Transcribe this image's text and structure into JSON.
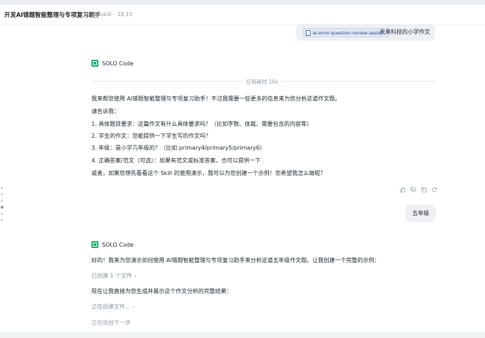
{
  "header": {
    "title": "开发AI错题智能整理与专项复习助手",
    "crumb_folder": "skill",
    "crumb_time": "18:15"
  },
  "user_message_1": {
    "chip_label": "ai-error-question-review-assist...",
    "text": "未来科技的小学作文"
  },
  "agent_name": "SOLO Code",
  "task_duration": "任务耗时 16s",
  "reply_1": {
    "intro": "我来帮您使用 AI错题智能整理与专项复习助手！不过我需要一些更多的信息来为您分析这道作文题。",
    "ask": "请告诉我：",
    "items": [
      "1. 具体题目要求：这篇作文有什么具体要求吗？（比如字数、体裁、需要包含的内容等）",
      "2. 学生的作文：您能提供一下学生写的作文吗？",
      "3. 年级：是小学几年级的？（比如 primary4/primary5/primary6）",
      "4. 正确答案/范文（可选）：如果有范文或标准答案，也可以提供一下"
    ],
    "outro": "或者，如果您想先看看这个 Skill 的使用演示，我可以为您创建一个示例！您希望我怎么做呢？"
  },
  "user_message_2": {
    "text": "五年级"
  },
  "reply_2": {
    "intro": "好的！我来为您演示如何使用 AI错题智能整理与专项复习助手来分析这道五年级作文题。让我创建一个完整的示例：",
    "created_files": "已创建 1 个文件",
    "next": "现在让我直接为您生成并展示这个作文分析的完整结果：",
    "creating": "正在创建文件...",
    "planning": "正在规划下一步"
  },
  "icons": [
    "thumbs-up-icon",
    "thumbs-down-icon",
    "copy-icon",
    "regenerate-icon",
    "folder-icon",
    "file-icon",
    "chevron-right-icon"
  ],
  "colors": {
    "accent_green": "#17b26a",
    "bubble_bg": "#eef0f3",
    "muted_text": "#8f959e"
  }
}
